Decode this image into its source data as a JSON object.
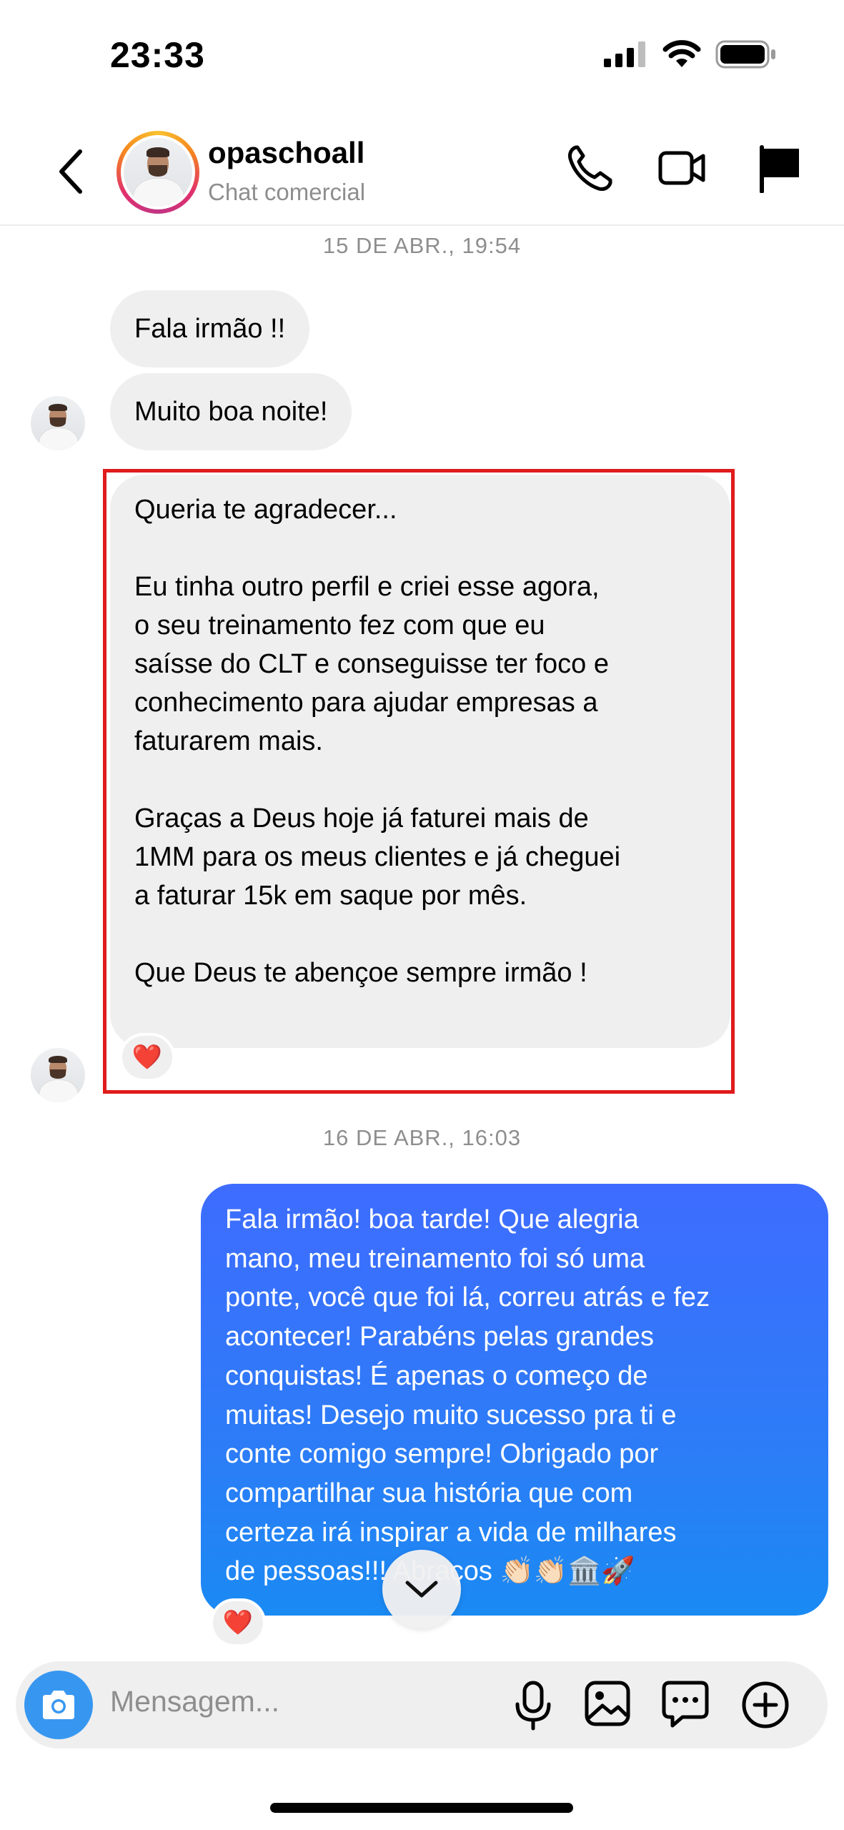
{
  "status_bar": {
    "time": "23:33"
  },
  "header": {
    "username": "opaschoall",
    "subtitle": "Chat comercial",
    "icons": [
      "back-chevron-icon",
      "phone-icon",
      "video-camera-icon",
      "flag-icon"
    ]
  },
  "messages": {
    "date1": "15 DE ABR., 19:54",
    "in1": "Fala irmão !!",
    "in2": "Muito boa noite!",
    "in3": "Queria te agradecer...\n\nEu tinha outro perfil e criei esse agora,\no seu treinamento fez com que eu\nsaísse do CLT e conseguisse ter foco e\nconhecimento para ajudar empresas a\nfaturarem mais.\n\nGraças a Deus hoje já faturei mais de\n1MM para os meus clientes e já cheguei\na faturar 15k em saque por mês.\n\nQue Deus te abençoe sempre irmão !",
    "in3_reaction": "❤️",
    "date2": "16 DE ABR., 16:03",
    "out1": "Fala irmão! boa tarde! Que alegria\nmano, meu treinamento foi só uma\nponte, você que foi lá, correu atrás e fez\nacontecer! Parabéns pelas grandes\nconquistas! É apenas o começo de\nmuitas! Desejo muito sucesso pra ti e\nconte comigo sempre! Obrigado por\ncompartilhar sua história que com\ncerteza irá inspirar a vida de milhares\nde pessoas!!! Abraços 👏🏻👏🏻🏛️🚀",
    "out1_reaction": "❤️"
  },
  "composer": {
    "placeholder": "Mensagem...",
    "icons": [
      "camera-icon",
      "microphone-icon",
      "image-icon",
      "chat-sticker-icon",
      "plus-circle-icon"
    ]
  },
  "colors": {
    "outgoing_bubble": "#3e6cff",
    "incoming_bubble": "#efefef",
    "camera_button": "#3797f0",
    "highlight_box": "#e01b1b"
  }
}
